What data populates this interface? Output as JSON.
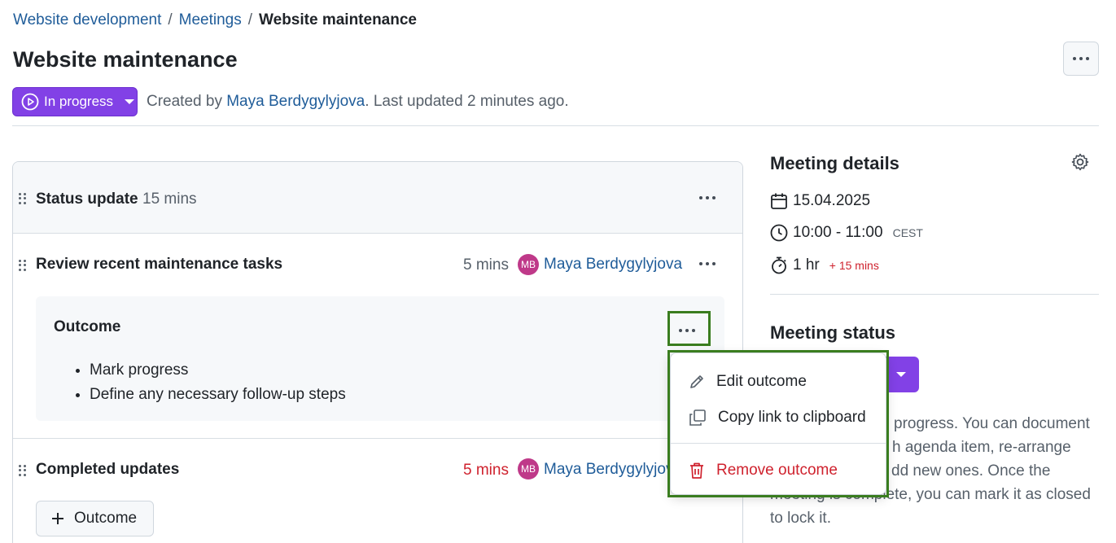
{
  "breadcrumb": {
    "items": [
      "Website development",
      "Meetings"
    ],
    "separator": "/",
    "current": "Website maintenance"
  },
  "page": {
    "title": "Website maintenance",
    "status_label": "In progress",
    "created_prefix": "Created by",
    "creator": "Maya Berdygylyjova",
    "updated_text": ". Last updated 2 minutes ago."
  },
  "agenda": {
    "section": {
      "title": "Status update",
      "duration": "15 mins"
    },
    "items": [
      {
        "title": "Review recent maintenance tasks",
        "duration": "5 mins",
        "avatar": "MB",
        "presenter": "Maya Berdygylyjova",
        "outcome": {
          "title": "Outcome",
          "bullets": [
            "Mark progress",
            "Define any necessary follow-up steps"
          ]
        }
      },
      {
        "title": "Completed updates",
        "duration": "5 mins",
        "avatar": "MB",
        "presenter": "Maya Berdygylyjova",
        "add_outcome_label": "Outcome"
      }
    ]
  },
  "menu": {
    "edit": "Edit outcome",
    "copy": "Copy link to clipboard",
    "remove": "Remove outcome"
  },
  "sidebar": {
    "details_title": "Meeting details",
    "date": "15.04.2025",
    "time": "10:00 - 11:00",
    "timezone": "CEST",
    "duration": "1 hr",
    "overrun": "+ 15 mins",
    "status_title": "Meeting status",
    "status_lines": [
      "progress. You can document",
      "h agenda item, re-arrange",
      "dd new ones. Once the",
      "meeting is complete, you can mark it as closed",
      "to lock it."
    ]
  },
  "colors": {
    "accent": "#8241e6",
    "link": "#1f5c99",
    "danger": "#cf222e",
    "highlight": "#3a7d1f"
  }
}
